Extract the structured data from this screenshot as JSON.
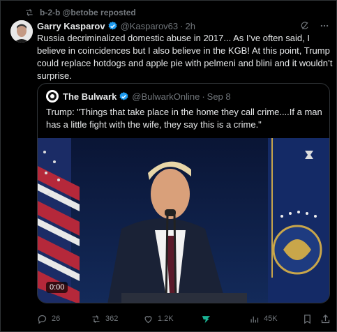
{
  "repost": {
    "text": "b-2-b @betobe reposted",
    "icon": "repost-icon"
  },
  "post": {
    "author_name": "Garry Kasparov",
    "handle": "@Kasparov63",
    "separator": "·",
    "time": "2h",
    "text": "Russia decriminalized domestic abuse in 2017... As I’ve often said, I believe in coincidences but I also believe in the KGB! At this point, Trump could replace hotdogs and apple pie with pelmeni and blini and it wouldn’t surprise.",
    "verified_color": "#1d9bf0"
  },
  "quote": {
    "author_name": "The Bulwark",
    "handle": "@BulwarkOnline",
    "separator": "·",
    "time": "Sep 8",
    "text": "Trump: \"Things that take place in the home they call crime....If a man has a little fight with the wife, they say this is a crime.\"",
    "video_time": "0:00"
  },
  "actions": {
    "replies": "26",
    "reposts": "362",
    "likes": "1.2K",
    "views": "45K"
  },
  "colors": {
    "background": "#000000",
    "text": "#e7e9ea",
    "muted": "#71767b",
    "border": "#2f3336",
    "grok": "#1ab394"
  }
}
